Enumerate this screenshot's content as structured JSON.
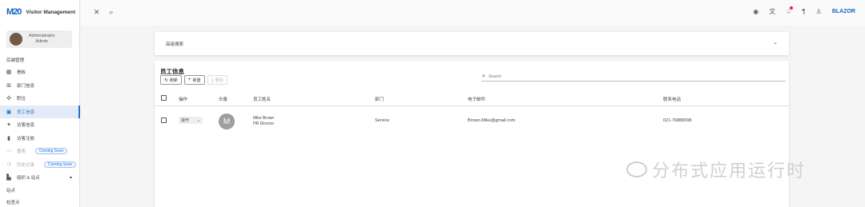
{
  "brand": {
    "logo": "M20",
    "name": "Visitor Management"
  },
  "user": {
    "name": "Administrator",
    "role": "Admin"
  },
  "sidebar": {
    "section_title": "后端管理",
    "items": [
      {
        "label": "看板",
        "icon": "dashboard-icon"
      },
      {
        "label": "部门信息",
        "icon": "org-chart-icon"
      },
      {
        "label": "职位",
        "icon": "position-icon"
      },
      {
        "label": "员工信息",
        "icon": "employee-badge-icon",
        "active": true
      },
      {
        "label": "访客信息",
        "icon": "walking-person-icon"
      },
      {
        "label": "访客注册",
        "icon": "book-icon"
      },
      {
        "label": "报表",
        "icon": "chart-icon",
        "disabled": true,
        "badge": "Coming Soon"
      },
      {
        "label": "历史记录",
        "icon": "history-icon",
        "disabled": true,
        "badge": "Coming Soon"
      },
      {
        "label": "组织 & 站点",
        "icon": "building-icon",
        "expanded": true
      }
    ],
    "sub_items": [
      "站点",
      "检查点"
    ]
  },
  "topbar": {
    "close_icon": "✕",
    "search_icon": "⌕",
    "brand_text": "BLAZOR"
  },
  "advanced_search": {
    "title": "高级搜索"
  },
  "table": {
    "title": "员工信息",
    "buttons": {
      "refresh": "刷新",
      "add": "新建",
      "delete": "删除"
    },
    "search_placeholder": "Search",
    "headers": [
      "操作",
      "头像",
      "员工姓名",
      "部门",
      "电子邮件",
      "联系电话"
    ],
    "rows": [
      {
        "action": "操作",
        "avatar_initial": "M",
        "name": "Mike Brown",
        "title": "HR Director",
        "department": "Service",
        "email": "Brown.Mike@gmail.com",
        "phone": "021-76888098"
      }
    ]
  },
  "watermark": {
    "text": "分布式应用运行时"
  },
  "colors": {
    "accent": "#1976d2",
    "active_bg": "#e3ebf7",
    "badge": "#e91e63"
  }
}
